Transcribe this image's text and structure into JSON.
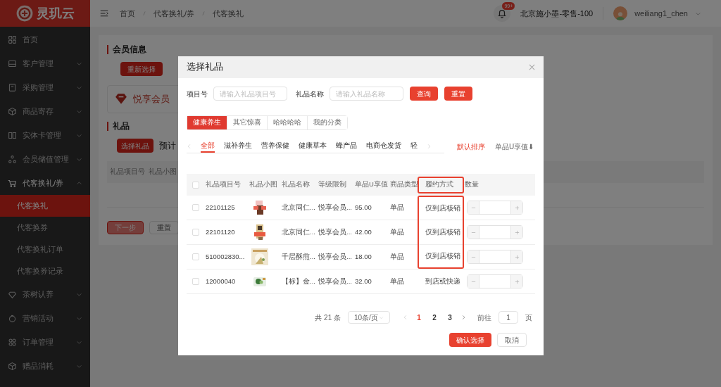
{
  "app": {
    "logo_text": "灵玑云"
  },
  "sidebar": {
    "items": [
      {
        "kind": "link",
        "label": "首页"
      },
      {
        "kind": "group",
        "label": "客户管理",
        "expanded": false
      },
      {
        "kind": "group",
        "label": "采购管理",
        "expanded": false
      },
      {
        "kind": "group",
        "label": "商品寄存",
        "expanded": false
      },
      {
        "kind": "group",
        "label": "实体卡管理",
        "expanded": false
      },
      {
        "kind": "group",
        "label": "会员储值管理",
        "expanded": false
      },
      {
        "kind": "group",
        "label": "代客换礼/券",
        "expanded": true,
        "children": [
          {
            "label": "代客换礼",
            "selected": true
          },
          {
            "label": "代客换券",
            "selected": false
          },
          {
            "label": "代客换礼订单",
            "selected": false
          },
          {
            "label": "代客换券记录",
            "selected": false
          }
        ]
      },
      {
        "kind": "group",
        "label": "茶树认养",
        "expanded": false
      },
      {
        "kind": "group",
        "label": "营销活动",
        "expanded": false
      },
      {
        "kind": "group",
        "label": "订单管理",
        "expanded": false
      },
      {
        "kind": "group",
        "label": "赠品消耗",
        "expanded": false
      }
    ]
  },
  "header": {
    "breadcrumb": [
      "首页",
      "代客换礼/券",
      "代客换礼"
    ],
    "notification_badge": "99+",
    "store": "北京施小墨-零售-100",
    "user": "weiliang1_chen"
  },
  "page": {
    "member_section": {
      "title": "会员信息",
      "reselect_button": "重新选择",
      "member_level": "悦享会员"
    },
    "gift_section": {
      "title": "礼品",
      "select_button": "选择礼品",
      "estimate_label": "预计",
      "columns": [
        "礼品项目号",
        "礼品小图"
      ]
    },
    "buttons": [
      {
        "label": "下一步",
        "disabled": true
      },
      {
        "label": "重置",
        "disabled": false
      }
    ]
  },
  "dialog": {
    "title": "选择礼品",
    "filters": [
      {
        "label": "项目号",
        "placeholder": "请输入礼品项目号"
      },
      {
        "label": "礼品名称",
        "placeholder": "请输入礼品名称"
      }
    ],
    "search_button": "查询",
    "reset_button": "重置",
    "group_tabs": [
      {
        "label": "健康养生",
        "selected": true
      },
      {
        "label": "其它惊喜",
        "selected": false
      },
      {
        "label": "哈哈哈哈",
        "selected": false
      },
      {
        "label": "我的分类",
        "selected": false
      }
    ],
    "category_tabs": [
      {
        "label": "全部",
        "selected": true
      },
      {
        "label": "滋补养生",
        "selected": false
      },
      {
        "label": "营养保健",
        "selected": false
      },
      {
        "label": "健康草本",
        "selected": false
      },
      {
        "label": "蜂产品",
        "selected": false
      },
      {
        "label": "电商仓发货",
        "selected": false
      },
      {
        "label": "轻",
        "selected": false
      }
    ],
    "sort_options": [
      {
        "label": "默认排序",
        "selected": true
      },
      {
        "label": "单品U享值⬇",
        "selected": false
      }
    ],
    "table": {
      "all_checked": false,
      "columns": [
        {
          "label": "礼品项目号",
          "highlighted": false
        },
        {
          "label": "礼品小图",
          "highlighted": false
        },
        {
          "label": "礼品名称",
          "highlighted": false
        },
        {
          "label": "等级限制",
          "highlighted": false
        },
        {
          "label": "单品U享值",
          "highlighted": false
        },
        {
          "label": "商品类型",
          "highlighted": false
        },
        {
          "label": "履约方式",
          "highlighted": true
        },
        {
          "label": "数量",
          "highlighted": false
        }
      ],
      "rows": [
        {
          "checked": false,
          "item_no": "22101125",
          "name": "北京同仁...",
          "level_limit": "悦享会员...",
          "value": "95.00",
          "type": "单品",
          "fulfillment": "仅到店核销",
          "fulfillment_highlighted": true
        },
        {
          "checked": false,
          "item_no": "22101120",
          "name": "北京同仁...",
          "level_limit": "悦享会员...",
          "value": "42.00",
          "type": "单品",
          "fulfillment": "仅到店核销",
          "fulfillment_highlighted": true
        },
        {
          "checked": false,
          "item_no": "510002830...",
          "name": "千层酥煎...",
          "level_limit": "悦享会员...",
          "value": "18.00",
          "type": "单品",
          "fulfillment": "仅到店核销",
          "fulfillment_highlighted": true
        },
        {
          "checked": false,
          "item_no": "12000040",
          "name": "【标】金...",
          "level_limit": "悦享会员...",
          "value": "32.00",
          "type": "单品",
          "fulfillment": "到店或快递",
          "fulfillment_highlighted": false
        }
      ]
    },
    "pagination": {
      "total": "共 21 条",
      "page_size": "10条/页",
      "pages": [
        {
          "label": "1",
          "selected": true
        },
        {
          "label": "2",
          "selected": false
        },
        {
          "label": "3",
          "selected": false
        }
      ],
      "goto_label": "前往",
      "goto_value": "1",
      "goto_suffix": "页"
    },
    "confirm_button": "确认选择",
    "cancel_button": "取消"
  }
}
